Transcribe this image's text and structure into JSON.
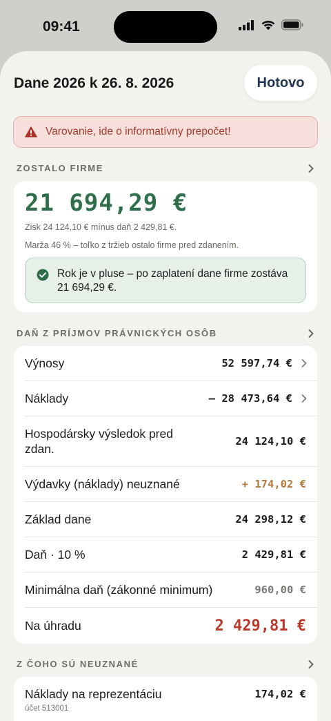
{
  "status_bar": {
    "time": "09:41"
  },
  "header": {
    "title": "Dane 2026 k 26. 8. 2026",
    "done_label": "Hotovo"
  },
  "warning": {
    "text": "Varovanie, ide o informatívny prepočet!"
  },
  "remaining": {
    "section_label": "ZOSTALO FIRME",
    "amount": "21 694,29 €",
    "profit_line": "Zisk 24 124,10 € mínus daň 2 429,81 €.",
    "margin_line": "Marža 46 % – toľko z tržieb ostalo firme pred zdanením.",
    "success_text": "Rok je v pluse – po zaplatení dane firme zostáva 21 694,29 €."
  },
  "tax": {
    "section_label": "DAŇ Z PRÍJMOV PRÁVNICKÝCH OSÔB",
    "rows": [
      {
        "label": "Výnosy",
        "value": "52 597,74 €"
      },
      {
        "label": "Náklady",
        "value": "– 28 473,64 €"
      },
      {
        "label": "Hospodársky výsledok pred zdan.",
        "value": "24 124,10 €"
      },
      {
        "label": "Výdavky (náklady) neuznané",
        "value": "+ 174,02 €"
      },
      {
        "label": "Základ dane",
        "value": "24 298,12 €"
      },
      {
        "label": "Daň · 10 %",
        "value": "2 429,81 €"
      },
      {
        "label": "Minimálna daň (zákonné minimum)",
        "value": "960,00 €"
      },
      {
        "label": "Na úhradu",
        "value": "2 429,81 €"
      }
    ]
  },
  "unrecognized": {
    "section_label": "Z ČOHO SÚ NEUZNANÉ",
    "items": [
      {
        "label": "Náklady na reprezentáciu",
        "sub": "účet 513001",
        "value": "174,02 €"
      }
    ]
  },
  "colors": {
    "accent_green": "#2f6e4b",
    "warning_red": "#a03a2e",
    "orange": "#b5793a",
    "due_red": "#b93a2b",
    "navy": "#1f3550"
  }
}
